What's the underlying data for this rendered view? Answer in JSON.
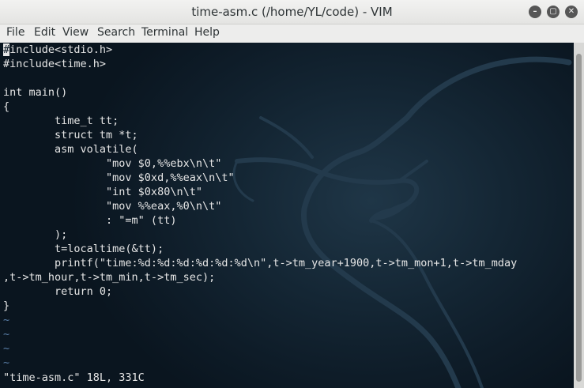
{
  "window": {
    "title": "time-asm.c (/home/YL/code) - VIM",
    "minimize": "–",
    "maximize": "▢",
    "close": "✕"
  },
  "menu": [
    "File",
    "Edit",
    "View",
    "Search",
    "Terminal",
    "Help"
  ],
  "code": {
    "lines": [
      "include<stdio.h>",
      "#include<time.h>",
      "",
      "int main()",
      "{",
      "        time_t tt;",
      "        struct tm *t;",
      "        asm volatile(",
      "                \"mov $0,%%ebx\\n\\t\"",
      "                \"mov $0xd,%%eax\\n\\t\"",
      "                \"int $0x80\\n\\t\"",
      "                \"mov %%eax,%0\\n\\t\"",
      "                : \"=m\" (tt)",
      "        );",
      "        t=localtime(&tt);",
      "        printf(\"time:%d:%d:%d:%d:%d:%d\\n\",t->tm_year+1900,t->tm_mon+1,t->tm_mday",
      ",t->tm_hour,t->tm_min,t->tm_sec);",
      "        return 0;",
      "}",
      "~",
      "~",
      "~",
      "~"
    ],
    "cursor_char": "#",
    "status": "\"time-asm.c\" 18L, 331C"
  },
  "colors": {
    "terminal_bg": "#0e1c28",
    "text": "#e6e6e6",
    "tilde": "#5a7fa8"
  },
  "icons": {
    "background": "kali-dragon-icon"
  }
}
